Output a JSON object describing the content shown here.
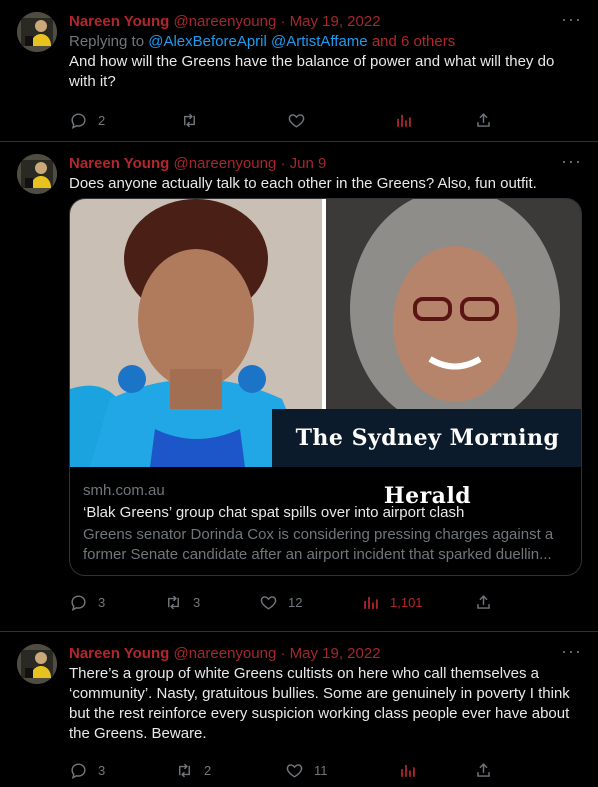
{
  "tweets": [
    {
      "name": "Nareen Young",
      "handle": "@nareenyoung",
      "dot": "·",
      "date": "May 19, 2022",
      "more": "···",
      "replying_prefix": "Replying to",
      "mention1": "@AlexBeforeApril",
      "mention2": "@ArtistAffame",
      "others": "and 6 others",
      "text": "And how will the Greens have the balance of power and what will they do with it?",
      "reply_count": "2",
      "retweet_count": "",
      "like_count": "",
      "view_count": ""
    },
    {
      "name": "Nareen Young",
      "handle": "@nareenyoung",
      "dot": "·",
      "date": "Jun 9",
      "more": "···",
      "text": "Does anyone actually talk to each other in the Greens? Also, fun outfit.",
      "card": {
        "logo": "The Sydney Morning Herald",
        "domain": "smh.com.au",
        "title": "‘Blak Greens’ group chat spat spills over into airport clash",
        "desc1": "Greens senator Dorinda Cox is considering pressing charges against a",
        "desc2": "former Senate candidate after an airport incident that sparked duellin..."
      },
      "reply_count": "3",
      "retweet_count": "3",
      "like_count": "12",
      "view_count": "1,101"
    },
    {
      "name": "Nareen Young",
      "handle": "@nareenyoung",
      "dot": "·",
      "date": "May 19, 2022",
      "more": "···",
      "text": "There’s a group of white Greens cultists on here who call themselves a ‘community’. Nasty, gratuitous bullies. Some are genuinely in poverty I think but the rest reinforce every suspicion working class people ever have about the Greens. Beware.",
      "reply_count": "3",
      "retweet_count": "2",
      "like_count": "11",
      "view_count": ""
    }
  ],
  "colors": {
    "background": "#000000",
    "name": "#b3262b",
    "link": "#1d9bf0",
    "muted": "#71767b"
  },
  "icons": [
    "reply-icon",
    "retweet-icon",
    "like-icon",
    "views-icon",
    "share-icon",
    "more-icon"
  ]
}
